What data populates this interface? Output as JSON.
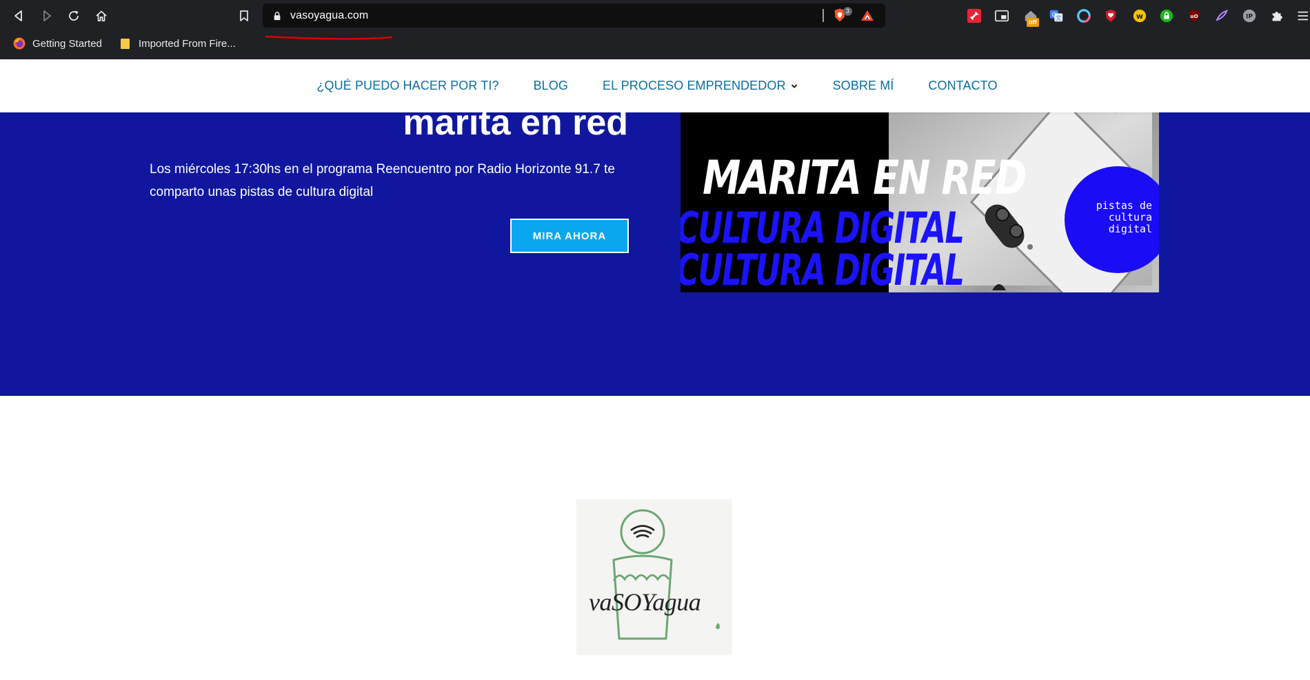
{
  "browser": {
    "url": "vasoyagua.com",
    "shield_count": "3",
    "extension_badge": "off",
    "bookmarks": [
      {
        "label": "Getting Started"
      },
      {
        "label": "Imported From Fire..."
      }
    ]
  },
  "site_nav": {
    "items": [
      {
        "label": "¿QUÉ PUEDO HACER POR TI?"
      },
      {
        "label": "BLOG"
      },
      {
        "label": "EL PROCESO EMPRENDEDOR"
      },
      {
        "label": "SOBRE MÍ"
      },
      {
        "label": "CONTACTO"
      }
    ]
  },
  "hero": {
    "title": "marita en red",
    "description": "Los miércoles 17:30hs en el programa Reencuentro por Radio Horizonte 91.7  te comparto unas pistas de cultura digital",
    "cta_label": "MIRA AHORA",
    "banner": {
      "headline": "MARITA EN RED",
      "sub_line_1": "CULTURA DIGITAL",
      "sub_line_2": "CULTURA DIGITAL",
      "circle_text": "pistas de cultura digital"
    }
  },
  "logo": {
    "text": "vaSOYagua"
  },
  "colors": {
    "browser_bg": "#202124",
    "nav_link": "#0c6d9c",
    "hero_bg": "#10179e",
    "cta_bg": "#0ba7ee",
    "banner_blue": "#1b12ff",
    "url_underline": "#e00000",
    "logo_green": "#6aa672"
  }
}
